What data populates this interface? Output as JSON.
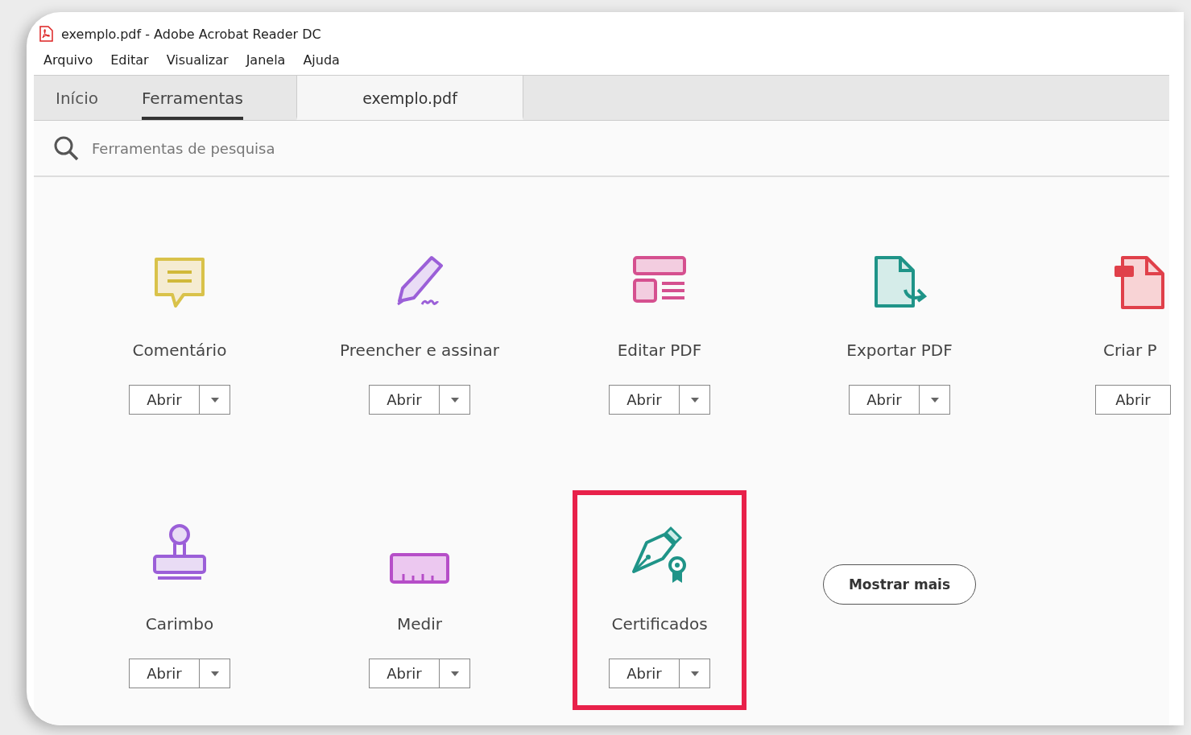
{
  "window": {
    "title": "exemplo.pdf - Adobe Acrobat Reader DC"
  },
  "menu": [
    "Arquivo",
    "Editar",
    "Visualizar",
    "Janela",
    "Ajuda"
  ],
  "tabs": [
    {
      "label": "Início",
      "kind": "home",
      "selected": false
    },
    {
      "label": "Ferramentas",
      "kind": "home",
      "selected": true
    },
    {
      "label": "exemplo.pdf",
      "kind": "document",
      "selected": false
    }
  ],
  "search": {
    "placeholder": "Ferramentas de pesquisa"
  },
  "tools": [
    {
      "kind": "comment",
      "name": "Comentário",
      "button": "Abrir",
      "highlighted": false
    },
    {
      "kind": "sign",
      "name": "Preencher e assinar",
      "button": "Abrir",
      "highlighted": false
    },
    {
      "kind": "edit",
      "name": "Editar PDF",
      "button": "Abrir",
      "highlighted": false
    },
    {
      "kind": "export",
      "name": "Exportar PDF",
      "button": "Abrir",
      "highlighted": false
    },
    {
      "kind": "create",
      "name": "Criar P",
      "button": "Abrir",
      "highlighted": false,
      "clipped": true
    },
    {
      "kind": "stamp",
      "name": "Carimbo",
      "button": "Abrir",
      "highlighted": false
    },
    {
      "kind": "measure",
      "name": "Medir",
      "button": "Abrir",
      "highlighted": false
    },
    {
      "kind": "certificate",
      "name": "Certificados",
      "button": "Abrir",
      "highlighted": true
    }
  ],
  "more_button": "Mostrar mais"
}
